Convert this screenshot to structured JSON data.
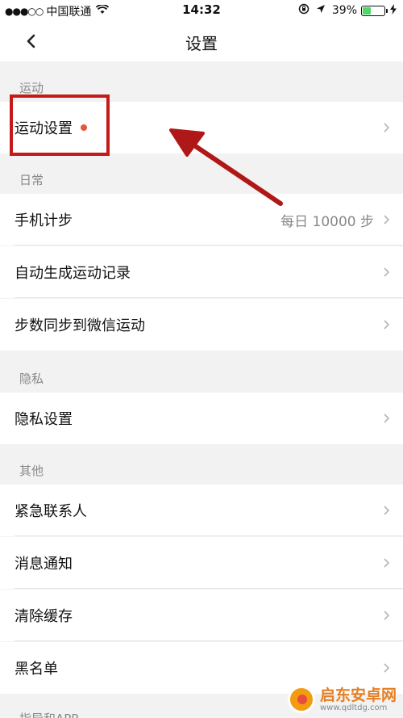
{
  "status_bar": {
    "signal": "●●●○○",
    "carrier": "中国联通",
    "time": "14:32",
    "battery_text": "39%",
    "battery_level": 0.39
  },
  "nav": {
    "title": "设置"
  },
  "sections": {
    "sport": {
      "header": "运动",
      "items": [
        {
          "label": "运动设置"
        }
      ]
    },
    "daily": {
      "header": "日常",
      "items": [
        {
          "label": "手机计步",
          "value": "每日 10000 步"
        },
        {
          "label": "自动生成运动记录"
        },
        {
          "label": "步数同步到微信运动"
        }
      ]
    },
    "privacy": {
      "header": "隐私",
      "items": [
        {
          "label": "隐私设置"
        }
      ]
    },
    "other": {
      "header": "其他",
      "items": [
        {
          "label": "紧急联系人"
        },
        {
          "label": "消息通知"
        },
        {
          "label": "清除缓存"
        },
        {
          "label": "黑名单"
        }
      ]
    },
    "bottom": {
      "header": "指导和APP"
    }
  },
  "watermark": {
    "title": "启东安卓网",
    "url": "www.qdltdg.com"
  },
  "colors": {
    "accent_red": "#c41a1a",
    "dot_red": "#e8553e",
    "battery_green": "#4cd964"
  }
}
